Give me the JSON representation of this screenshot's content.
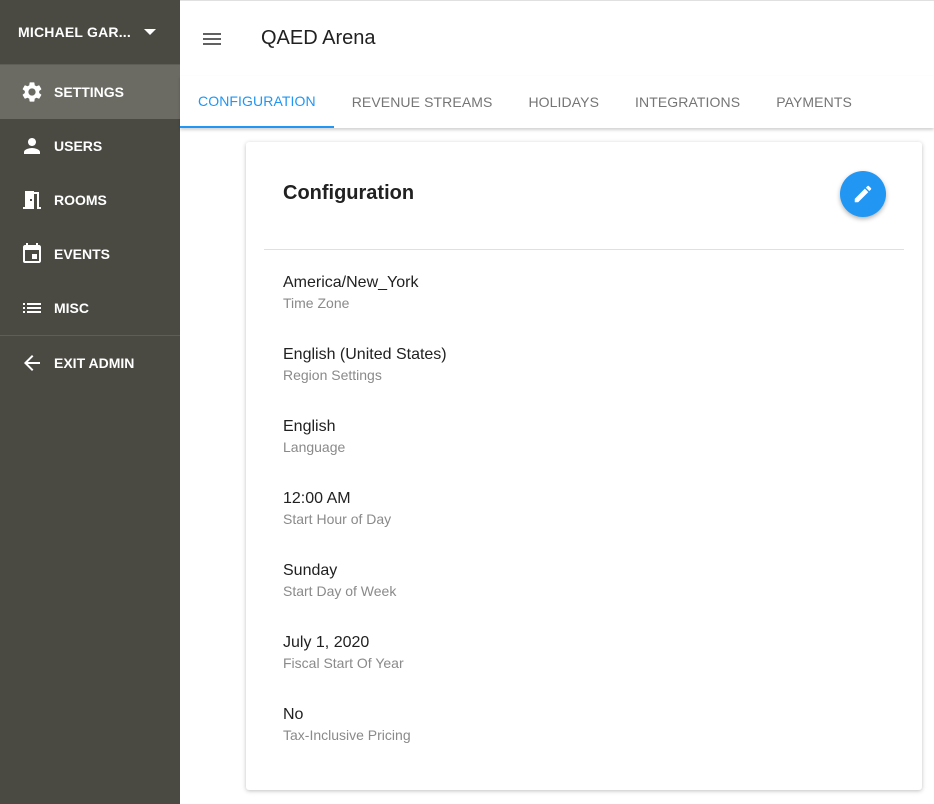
{
  "sidebar": {
    "user_name": "MICHAEL GAR...",
    "items": [
      {
        "label": "SETTINGS",
        "icon": "gear-icon"
      },
      {
        "label": "USERS",
        "icon": "person-icon"
      },
      {
        "label": "ROOMS",
        "icon": "door-icon"
      },
      {
        "label": "EVENTS",
        "icon": "calendar-icon"
      },
      {
        "label": "MISC",
        "icon": "list-icon"
      }
    ],
    "exit": {
      "label": "EXIT ADMIN",
      "icon": "arrow-left-icon"
    }
  },
  "header": {
    "title": "QAED Arena",
    "menu_icon": "hamburger-icon"
  },
  "tabs": [
    {
      "label": "CONFIGURATION",
      "active": true
    },
    {
      "label": "REVENUE STREAMS"
    },
    {
      "label": "HOLIDAYS"
    },
    {
      "label": "INTEGRATIONS"
    },
    {
      "label": "PAYMENTS"
    }
  ],
  "card": {
    "title": "Configuration",
    "edit_icon": "pencil-icon",
    "fields": [
      {
        "value": "America/New_York",
        "label": "Time Zone"
      },
      {
        "value": "English (United States)",
        "label": "Region Settings"
      },
      {
        "value": "English",
        "label": "Language"
      },
      {
        "value": "12:00 AM",
        "label": "Start Hour of Day"
      },
      {
        "value": "Sunday",
        "label": "Start Day of Week"
      },
      {
        "value": "July 1, 2020",
        "label": "Fiscal Start Of Year"
      },
      {
        "value": "No",
        "label": "Tax-Inclusive Pricing"
      }
    ]
  },
  "colors": {
    "sidebar_bg": "#4a4a42",
    "sidebar_active": "#6b6b64",
    "accent": "#2196f3"
  }
}
